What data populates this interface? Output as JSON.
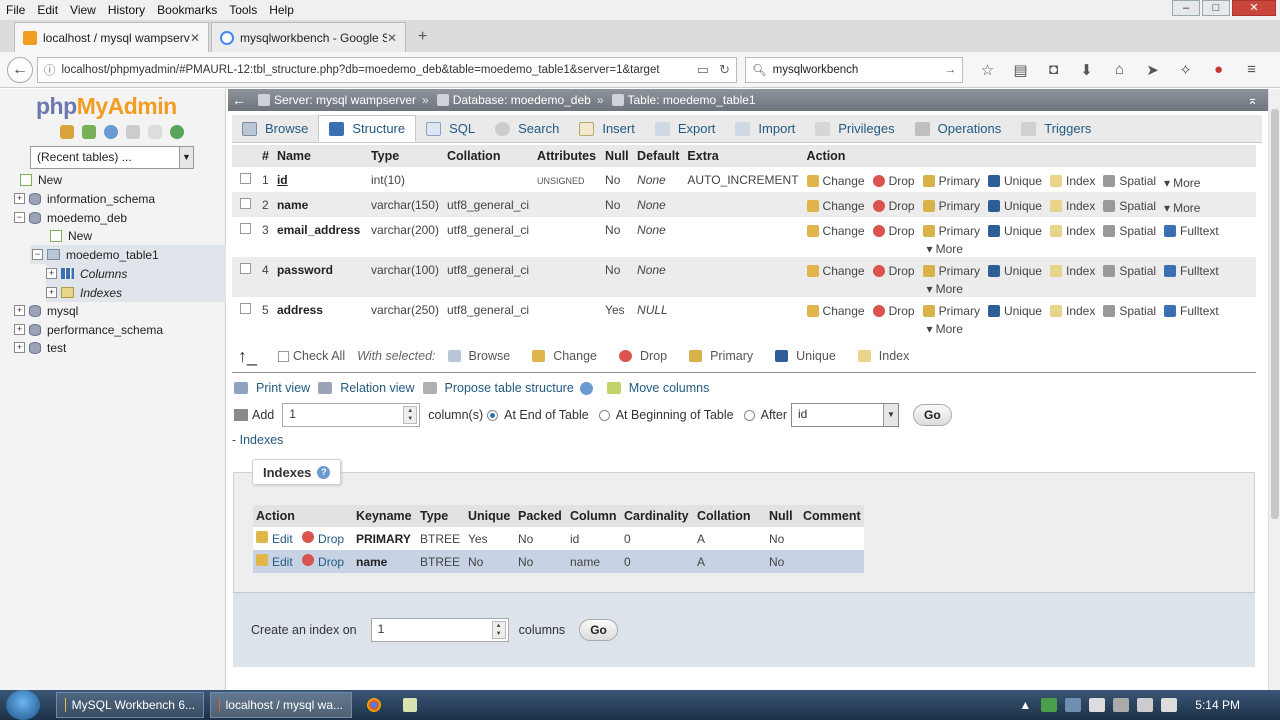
{
  "menubar": [
    "File",
    "Edit",
    "View",
    "History",
    "Bookmarks",
    "Tools",
    "Help"
  ],
  "tabs": [
    {
      "label": "localhost / mysql wampserv",
      "active": true
    },
    {
      "label": "mysqlworkbench - Google S",
      "active": false
    }
  ],
  "url": "localhost/phpmyadmin/#PMAURL-12:tbl_structure.php?db=moedemo_deb&table=moedemo_table1&server=1&target",
  "search_value": "mysqlworkbench",
  "logo": {
    "php": "php",
    "myadmin": "MyAdmin"
  },
  "recent_tables": "(Recent tables) ...",
  "tree": {
    "new_root": "New",
    "dbs": [
      "information_schema",
      "moedemo_deb",
      "mysql",
      "performance_schema",
      "test"
    ],
    "new_db": "New",
    "table": "moedemo_table1",
    "columns": "Columns",
    "indexes": "Indexes"
  },
  "breadcrumb": {
    "server": "Server: mysql wampserver",
    "database": "Database: moedemo_deb",
    "table": "Table: moedemo_table1"
  },
  "pma_tabs": [
    "Browse",
    "Structure",
    "SQL",
    "Search",
    "Insert",
    "Export",
    "Import",
    "Privileges",
    "Operations",
    "Triggers"
  ],
  "struct_headers": [
    "#",
    "Name",
    "Type",
    "Collation",
    "Attributes",
    "Null",
    "Default",
    "Extra",
    "Action"
  ],
  "columns": [
    {
      "num": "1",
      "name": "id",
      "type": "int(10)",
      "collation": "",
      "attributes": "UNSIGNED",
      "null": "No",
      "default": "None",
      "extra": "AUTO_INCREMENT",
      "last": "More"
    },
    {
      "num": "2",
      "name": "name",
      "type": "varchar(150)",
      "collation": "utf8_general_ci",
      "attributes": "",
      "null": "No",
      "default": "None",
      "extra": "",
      "last": "More"
    },
    {
      "num": "3",
      "name": "email_address",
      "type": "varchar(200)",
      "collation": "utf8_general_ci",
      "attributes": "",
      "null": "No",
      "default": "None",
      "extra": "",
      "last": "Fulltext"
    },
    {
      "num": "4",
      "name": "password",
      "type": "varchar(100)",
      "collation": "utf8_general_ci",
      "attributes": "",
      "null": "No",
      "default": "None",
      "extra": "",
      "last": "Fulltext"
    },
    {
      "num": "5",
      "name": "address",
      "type": "varchar(250)",
      "collation": "utf8_general_ci",
      "attributes": "",
      "null": "Yes",
      "default": "NULL",
      "extra": "",
      "last": "Fulltext"
    }
  ],
  "row_actions": {
    "change": "Change",
    "drop": "Drop",
    "primary": "Primary",
    "unique": "Unique",
    "index": "Index",
    "spatial": "Spatial",
    "more": "More"
  },
  "with_selected": {
    "check_all": "Check All",
    "label": "With selected:",
    "browse": "Browse",
    "change": "Change",
    "drop": "Drop",
    "primary": "Primary",
    "unique": "Unique",
    "index": "Index"
  },
  "links": {
    "print_view": "Print view",
    "relation_view": "Relation view",
    "propose": "Propose table structure",
    "move_columns": "Move columns"
  },
  "add": {
    "label": "Add",
    "count": "1",
    "columns_label": "column(s)",
    "end": "At End of Table",
    "beginning": "At Beginning of Table",
    "after": "After",
    "after_value": "id",
    "go": "Go"
  },
  "indexes_link": "- Indexes",
  "indexes": {
    "legend": "Indexes",
    "headers": [
      "Action",
      "Keyname",
      "Type",
      "Unique",
      "Packed",
      "Column",
      "Cardinality",
      "Collation",
      "Null",
      "Comment"
    ],
    "rows": [
      {
        "edit": "Edit",
        "drop": "Drop",
        "keyname": "PRIMARY",
        "type": "BTREE",
        "unique": "Yes",
        "packed": "No",
        "column": "id",
        "cardinality": "0",
        "collation": "A",
        "null": "No",
        "comment": ""
      },
      {
        "edit": "Edit",
        "drop": "Drop",
        "keyname": "name",
        "type": "BTREE",
        "unique": "No",
        "packed": "No",
        "column": "name",
        "cardinality": "0",
        "collation": "A",
        "null": "No",
        "comment": ""
      }
    ],
    "create_label": "Create an index on",
    "create_value": "1",
    "create_suffix": "columns",
    "go": "Go"
  },
  "taskbar": {
    "task1": "MySQL Workbench 6...",
    "task2": "localhost / mysql wa...",
    "clock": "5:14 PM"
  }
}
